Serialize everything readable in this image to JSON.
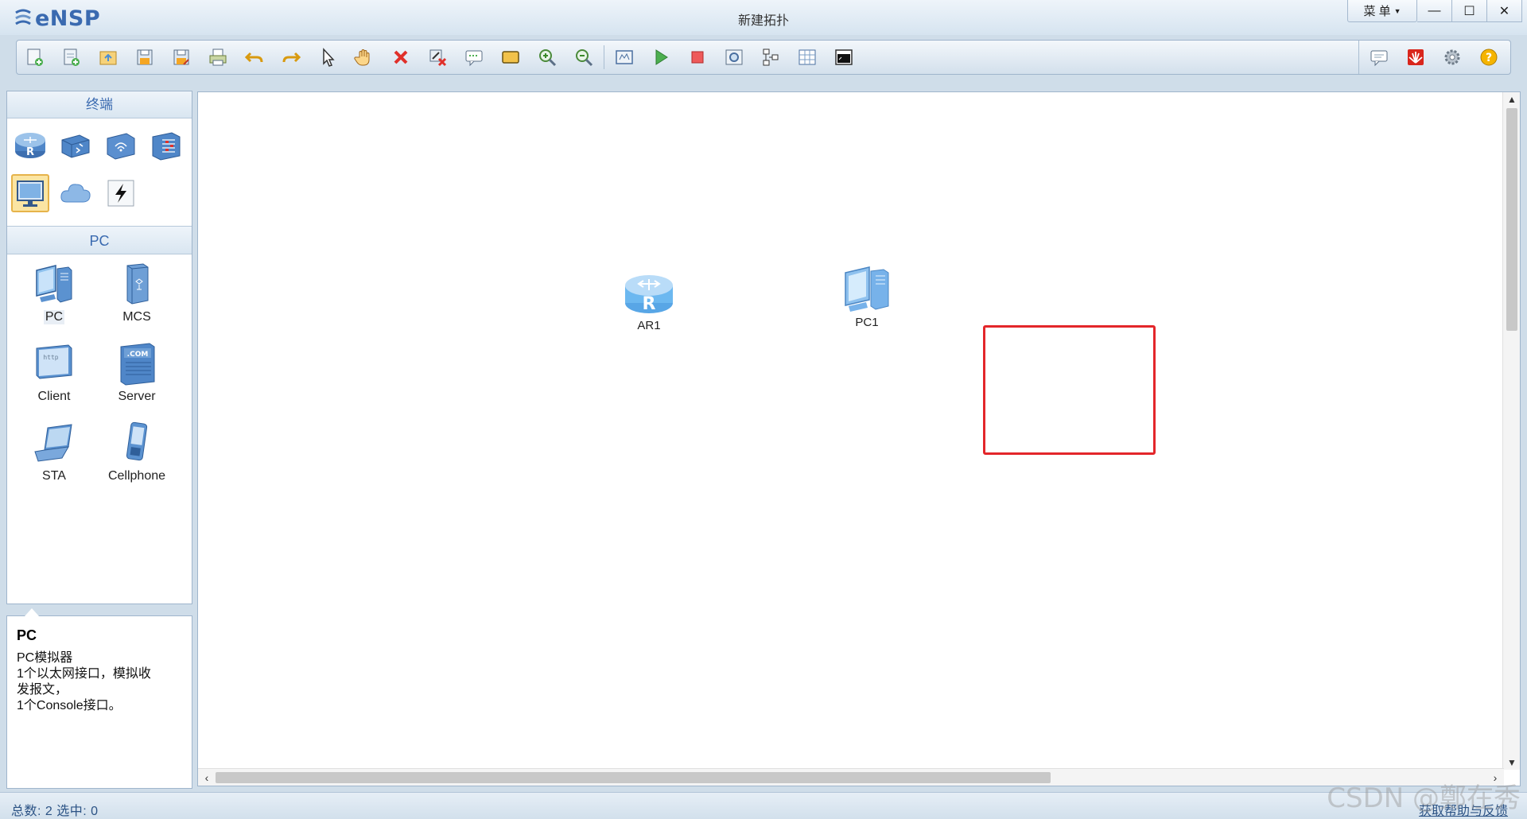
{
  "app": {
    "name": "eNSP",
    "window_title": "新建拓扑"
  },
  "window_controls": {
    "menu_label": "菜 单",
    "minimize": "—",
    "maximize": "☐",
    "close": "✕"
  },
  "toolbar": {
    "buttons": [
      {
        "name": "new-topology",
        "icon": "new-file-icon"
      },
      {
        "name": "new-test",
        "icon": "new-test-icon"
      },
      {
        "name": "open",
        "icon": "open-icon"
      },
      {
        "name": "save",
        "icon": "save-icon"
      },
      {
        "name": "save-as",
        "icon": "save-as-icon"
      },
      {
        "name": "print",
        "icon": "print-icon"
      },
      {
        "name": "undo",
        "icon": "undo-icon"
      },
      {
        "name": "redo",
        "icon": "redo-icon"
      },
      {
        "name": "select",
        "icon": "pointer-icon"
      },
      {
        "name": "drag",
        "icon": "hand-icon"
      },
      {
        "name": "delete",
        "icon": "delete-icon"
      },
      {
        "name": "delete-all-links",
        "icon": "delete-links-icon"
      },
      {
        "name": "text",
        "icon": "text-icon"
      },
      {
        "name": "shape",
        "icon": "rectangle-icon"
      },
      {
        "name": "zoom-in",
        "icon": "zoom-in-icon"
      },
      {
        "name": "zoom-out",
        "icon": "zoom-out-icon"
      },
      {
        "name": "fit",
        "icon": "fit-icon"
      },
      {
        "name": "start",
        "icon": "play-icon"
      },
      {
        "name": "stop",
        "icon": "stop-icon"
      },
      {
        "name": "capture",
        "icon": "capture-icon"
      },
      {
        "name": "topology",
        "icon": "topology-icon"
      },
      {
        "name": "grid",
        "icon": "grid-icon"
      },
      {
        "name": "terminal",
        "icon": "terminal-icon"
      }
    ],
    "right_buttons": [
      {
        "name": "forum",
        "icon": "chat-icon"
      },
      {
        "name": "huawei",
        "icon": "huawei-icon"
      },
      {
        "name": "settings",
        "icon": "gear-icon"
      },
      {
        "name": "help",
        "icon": "help-icon"
      }
    ]
  },
  "palette": {
    "title": "终端",
    "categories": [
      {
        "name": "router",
        "icon": "router-icon"
      },
      {
        "name": "switch",
        "icon": "switch-icon"
      },
      {
        "name": "wlan",
        "icon": "wireless-icon"
      },
      {
        "name": "firewall",
        "icon": "firewall-icon"
      },
      {
        "name": "terminal",
        "icon": "monitor-icon",
        "selected": true
      },
      {
        "name": "cloud",
        "icon": "cloud-icon"
      },
      {
        "name": "link",
        "icon": "lightning-icon"
      }
    ],
    "sub_title": "PC",
    "devices": [
      {
        "label": "PC",
        "icon": "pc-icon"
      },
      {
        "label": "MCS",
        "icon": "mcs-icon"
      },
      {
        "label": "Client",
        "icon": "client-icon"
      },
      {
        "label": "Server",
        "icon": "server-icon"
      },
      {
        "label": "STA",
        "icon": "laptop-icon"
      },
      {
        "label": "Cellphone",
        "icon": "cellphone-icon"
      }
    ]
  },
  "info": {
    "title": "PC",
    "lines": [
      "PC模拟器",
      "1个以太网接口，模拟收",
      "发报文，",
      "1个Console接口。"
    ]
  },
  "canvas": {
    "nodes": [
      {
        "label": "AR1",
        "icon": "router-icon"
      },
      {
        "label": "PC1",
        "icon": "pc-icon"
      }
    ]
  },
  "status": {
    "text": "总数: 2  选中: 0",
    "help_link": "获取帮助与反馈"
  },
  "watermark": "CSDN @鄭在秀",
  "colors": {
    "accent": "#3a6ab0",
    "highlight": "#e3262a",
    "selected_bg": "#fbe5a3"
  }
}
